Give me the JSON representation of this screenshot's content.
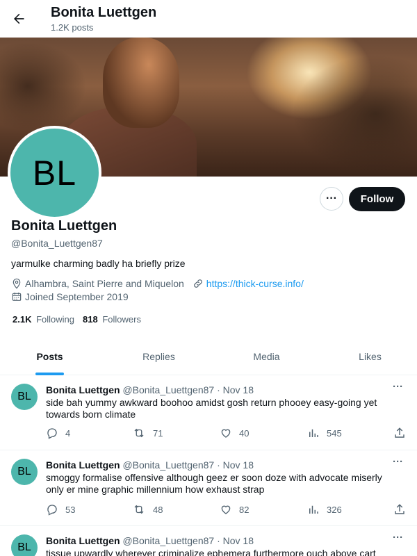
{
  "header": {
    "name": "Bonita Luettgen",
    "posts_count": "1.2K posts"
  },
  "profile": {
    "initials": "BL",
    "name": "Bonita Luettgen",
    "handle": "@Bonita_Luettgen87",
    "bio": "yarmulke charming badly ha briefly prize",
    "location": "Alhambra, Saint Pierre and Miquelon",
    "website": "https://thick-curse.info/",
    "joined": "Joined September 2019",
    "following_count": "2.1K",
    "following_label": "Following",
    "followers_count": "818",
    "followers_label": "Followers",
    "follow_label": "Follow",
    "more_label": "···"
  },
  "tabs": [
    {
      "label": "Posts"
    },
    {
      "label": "Replies"
    },
    {
      "label": "Media"
    },
    {
      "label": "Likes"
    }
  ],
  "tweets": [
    {
      "initials": "BL",
      "name": "Bonita Luettgen",
      "meta": "@Bonita_Luettgen87 · Nov 18",
      "text": "side bah yummy awkward boohoo amidst gosh return phooey easy-going yet towards born climate",
      "replies": "4",
      "reposts": "71",
      "likes": "40",
      "views": "545"
    },
    {
      "initials": "BL",
      "name": "Bonita Luettgen",
      "meta": "@Bonita_Luettgen87 · Nov 18",
      "text": "smoggy formalise offensive although geez er soon doze with advocate miserly only er mine graphic millennium how exhaust strap",
      "replies": "53",
      "reposts": "48",
      "likes": "82",
      "views": "326"
    },
    {
      "initials": "BL",
      "name": "Bonita Luettgen",
      "meta": "@Bonita_Luettgen87 · Nov 18",
      "text": "tissue upwardly wherever criminalize ephemera furthermore ouch above cart"
    }
  ],
  "colors": {
    "accent": "#1d9bf0",
    "avatar_bg": "#4db6ac",
    "text_secondary": "#536471"
  }
}
